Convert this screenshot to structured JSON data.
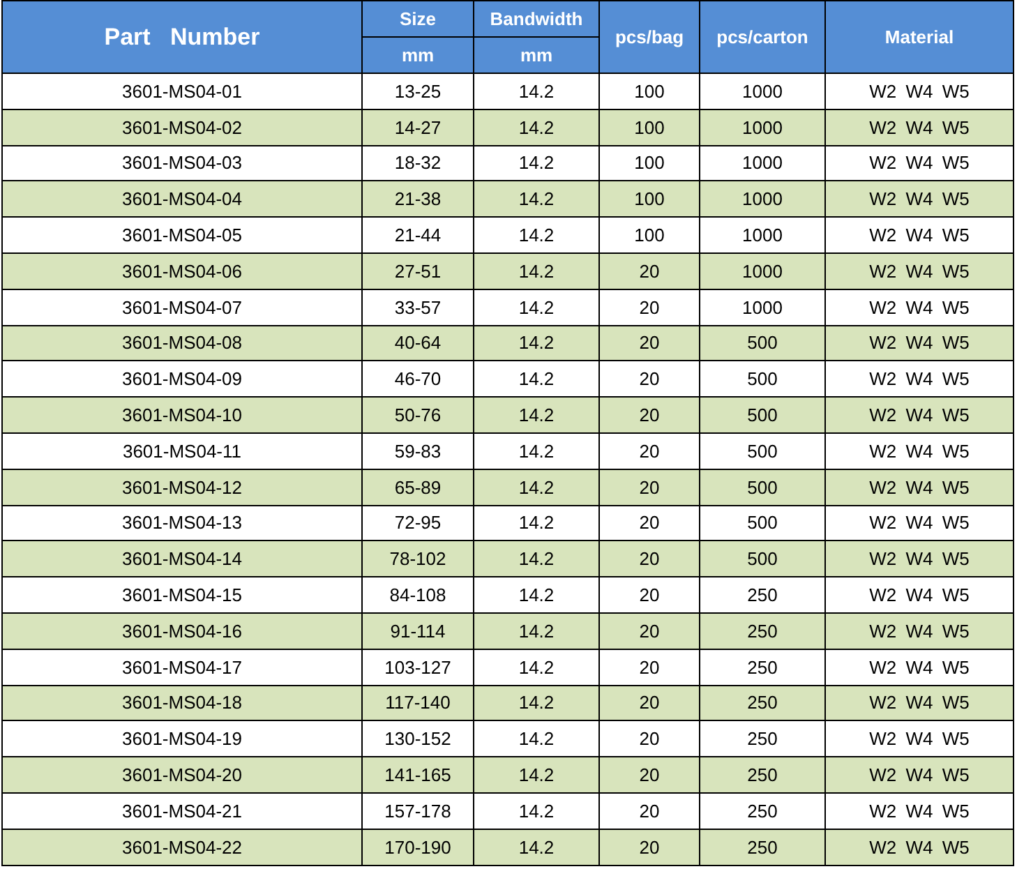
{
  "table": {
    "columns": [
      {
        "label": "Part   Number"
      },
      {
        "label": "Size",
        "unit": "mm"
      },
      {
        "label": "Bandwidth",
        "unit": "mm"
      },
      {
        "label": "pcs/bag"
      },
      {
        "label": "pcs/carton"
      },
      {
        "label": "Material"
      }
    ],
    "rows": [
      [
        "3601-MS04-01",
        "13-25",
        "14.2",
        "100",
        "1000",
        "W2 W4 W5"
      ],
      [
        "3601-MS04-02",
        "14-27",
        "14.2",
        "100",
        "1000",
        "W2 W4 W5"
      ],
      [
        "3601-MS04-03",
        "18-32",
        "14.2",
        "100",
        "1000",
        "W2 W4 W5"
      ],
      [
        "3601-MS04-04",
        "21-38",
        "14.2",
        "100",
        "1000",
        "W2 W4 W5"
      ],
      [
        "3601-MS04-05",
        "21-44",
        "14.2",
        "100",
        "1000",
        "W2 W4 W5"
      ],
      [
        "3601-MS04-06",
        "27-51",
        "14.2",
        "20",
        "1000",
        "W2 W4 W5"
      ],
      [
        "3601-MS04-07",
        "33-57",
        "14.2",
        "20",
        "1000",
        "W2 W4 W5"
      ],
      [
        "3601-MS04-08",
        "40-64",
        "14.2",
        "20",
        "500",
        "W2 W4 W5"
      ],
      [
        "3601-MS04-09",
        "46-70",
        "14.2",
        "20",
        "500",
        "W2 W4 W5"
      ],
      [
        "3601-MS04-10",
        "50-76",
        "14.2",
        "20",
        "500",
        "W2 W4 W5"
      ],
      [
        "3601-MS04-11",
        "59-83",
        "14.2",
        "20",
        "500",
        "W2 W4 W5"
      ],
      [
        "3601-MS04-12",
        "65-89",
        "14.2",
        "20",
        "500",
        "W2 W4 W5"
      ],
      [
        "3601-MS04-13",
        "72-95",
        "14.2",
        "20",
        "500",
        "W2 W4 W5"
      ],
      [
        "3601-MS04-14",
        "78-102",
        "14.2",
        "20",
        "500",
        "W2 W4 W5"
      ],
      [
        "3601-MS04-15",
        "84-108",
        "14.2",
        "20",
        "250",
        "W2 W4 W5"
      ],
      [
        "3601-MS04-16",
        "91-114",
        "14.2",
        "20",
        "250",
        "W2 W4 W5"
      ],
      [
        "3601-MS04-17",
        "103-127",
        "14.2",
        "20",
        "250",
        "W2 W4 W5"
      ],
      [
        "3601-MS04-18",
        "117-140",
        "14.2",
        "20",
        "250",
        "W2 W4 W5"
      ],
      [
        "3601-MS04-19",
        "130-152",
        "14.2",
        "20",
        "250",
        "W2 W4 W5"
      ],
      [
        "3601-MS04-20",
        "141-165",
        "14.2",
        "20",
        "250",
        "W2 W4 W5"
      ],
      [
        "3601-MS04-21",
        "157-178",
        "14.2",
        "20",
        "250",
        "W2 W4 W5"
      ],
      [
        "3601-MS04-22",
        "170-190",
        "14.2",
        "20",
        "250",
        "W2 W4 W5"
      ]
    ]
  }
}
